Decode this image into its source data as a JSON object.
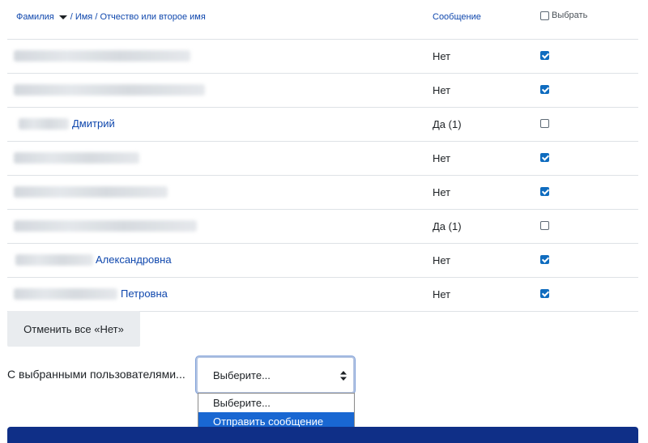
{
  "header": {
    "sort_surname": "Фамилия",
    "sort_firstname": "/ Имя",
    "sort_middlename": "/ Отчество или второе имя",
    "message_col": "Сообщение",
    "select_col": "Выбрать"
  },
  "rows": [
    {
      "name_visible": "",
      "status": "Нет",
      "checked": true
    },
    {
      "name_visible": "",
      "status": "Нет",
      "checked": true
    },
    {
      "name_visible": "Дмитрий",
      "status": "Да (1)",
      "checked": false
    },
    {
      "name_visible": "",
      "status": "Нет",
      "checked": true
    },
    {
      "name_visible": "",
      "status": "Нет",
      "checked": true
    },
    {
      "name_visible": "",
      "status": "Да (1)",
      "checked": false
    },
    {
      "name_visible": "Александровна",
      "status": "Нет",
      "checked": true
    },
    {
      "name_visible": "Петровна",
      "status": "Нет",
      "checked": true
    }
  ],
  "cancel_button": "Отменить все «Нет»",
  "with_selected_label": "С выбранными пользователями...",
  "action_select": {
    "value": "Выберите...",
    "options": [
      "Выберите...",
      "Отправить сообщение"
    ],
    "highlighted_index": 1
  },
  "colors": {
    "link": "#0f47ad",
    "highlight": "#1967d2",
    "checkbox": "#0f6cbf",
    "footer_bar": "#0f2f87"
  }
}
